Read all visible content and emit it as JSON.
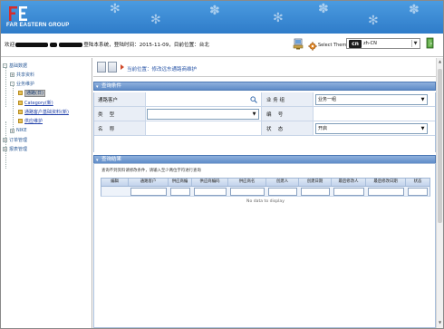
{
  "header": {
    "logo_text": "FAR EASTERN GROUP"
  },
  "infobar": {
    "welcome_prefix": "欢迎",
    "login_info": "登陆本系统，登陆时间：2015-11-09，目前位置：台北",
    "select_theme_label": "Select Theme",
    "language_value": "zh-CN"
  },
  "tree": {
    "items": [
      {
        "label": "基础数据",
        "toggle": "-"
      },
      {
        "label": "共享资料",
        "toggle": "+"
      },
      {
        "label": "业务维护",
        "toggle": "-"
      },
      {
        "label": "通路(日)"
      },
      {
        "label": "Category(新)"
      },
      {
        "label": "通路客户基础资料(新)"
      },
      {
        "label": "供应维护"
      },
      {
        "label": "NIKE",
        "toggle": "+"
      },
      {
        "label": "订单管理",
        "toggle": "+"
      },
      {
        "label": "报表管理",
        "toggle": "+"
      }
    ]
  },
  "main": {
    "breadcrumb": "当前位置：修改远东通路商维护",
    "query_section_title": "查询条件",
    "query": {
      "customer_label": "通路客户",
      "customer_value": "",
      "business_group_label": "业 务 组",
      "business_group_value": "业务一组",
      "category_label": "类　 型",
      "category_value": "",
      "code_label": "编　 号",
      "code_value": "",
      "name_label": "名　 称",
      "name_value": "",
      "status_label": "状　 态",
      "status_value": "开启"
    },
    "results_section_title": "查询结果",
    "results_hint": "查询不到资料请修改条件，请输入至少两位字符进行查询",
    "columns": [
      "编辑",
      "通路客户",
      "供应商编",
      "供应商编码",
      "供应商名",
      "创建人",
      "创建日期",
      "最后修改人",
      "最后修改日期",
      "状态"
    ],
    "no_data": "No data to display"
  },
  "colors": {
    "banner": "#2f7cc9",
    "section_header": "#5f8cc8",
    "link": "#2b57a8"
  }
}
